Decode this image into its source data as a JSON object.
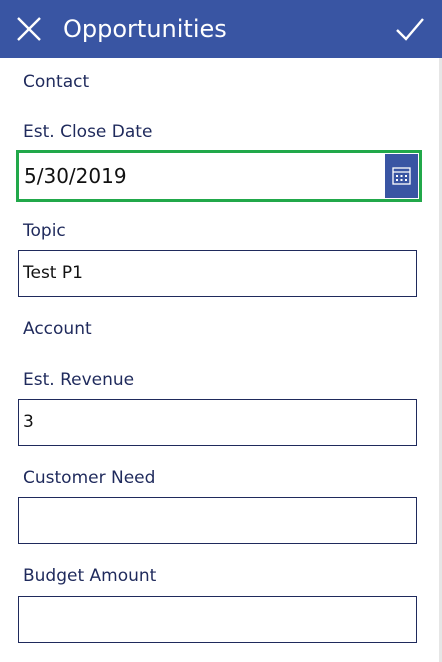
{
  "header": {
    "title": "Opportunities",
    "close_icon": "close-icon",
    "confirm_icon": "checkmark-icon"
  },
  "form": {
    "contact_label": "Contact",
    "close_date_label": "Est. Close Date",
    "close_date_value": "5/30/2019",
    "calendar_icon": "calendar-icon",
    "topic_label": "Topic",
    "topic_value": "Test P1",
    "account_label": "Account",
    "revenue_label": "Est. Revenue",
    "revenue_value": "3",
    "customer_need_label": "Customer Need",
    "customer_need_value": "",
    "budget_label": "Budget Amount",
    "budget_value": ""
  },
  "colors": {
    "header_bg": "#3955a3",
    "focus_border": "#21a84a",
    "label_text": "#1f2a5c"
  }
}
